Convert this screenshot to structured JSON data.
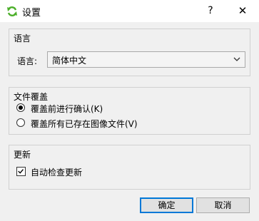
{
  "window": {
    "title": "设置",
    "help_label": "?",
    "close_label": "✕"
  },
  "language_group": {
    "title": "语言",
    "label": "语言:",
    "selected": "简体中文"
  },
  "overwrite_group": {
    "title": "文件覆盖",
    "options": [
      {
        "label": "覆盖前进行确认(K)",
        "checked": true
      },
      {
        "label": "覆盖所有已存在图像文件(V)",
        "checked": false
      }
    ]
  },
  "update_group": {
    "title": "更新",
    "auto_check_label": "自动检查更新",
    "auto_check": true
  },
  "buttons": {
    "ok_label": "确定",
    "cancel_label": "取消"
  },
  "colors": {
    "window_bg": "#f0f0f0",
    "titlebar_bg": "#ffffff",
    "default_button_border": "#0078d7",
    "app_icon": "#4caf2a"
  }
}
